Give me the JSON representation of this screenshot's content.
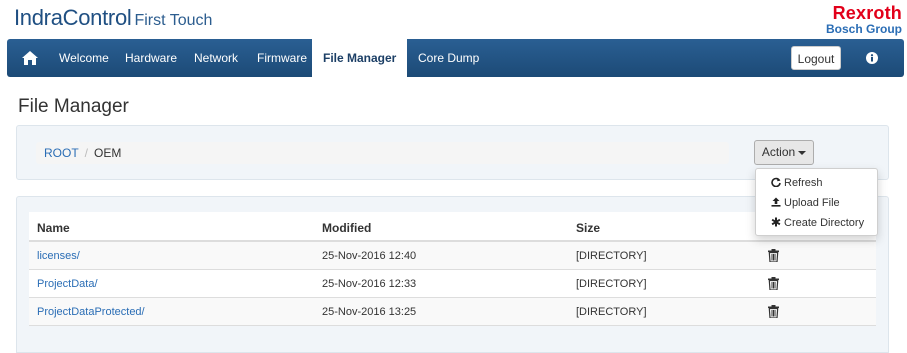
{
  "header": {
    "brand_main": "IndraControl",
    "brand_sub": "First Touch",
    "logo_line1": "Rexroth",
    "logo_line2": "Bosch Group"
  },
  "nav": {
    "home_icon": "home-icon",
    "items": [
      {
        "label": "Welcome",
        "active": false
      },
      {
        "label": "Hardware",
        "active": false
      },
      {
        "label": "Network",
        "active": false
      },
      {
        "label": "Firmware",
        "active": false
      },
      {
        "label": "File Manager",
        "active": true
      },
      {
        "label": "Core Dump",
        "active": false
      }
    ],
    "logout_label": "Logout",
    "info_icon": "info-icon"
  },
  "page": {
    "title": "File Manager"
  },
  "breadcrumb": {
    "root": "ROOT",
    "separator": "/",
    "current": "OEM"
  },
  "action": {
    "label": "Action",
    "menu": [
      {
        "icon": "refresh-icon",
        "label": "Refresh"
      },
      {
        "icon": "upload-icon",
        "label": "Upload File"
      },
      {
        "icon": "asterisk-icon",
        "label": "Create Directory"
      }
    ]
  },
  "table": {
    "columns": [
      "Name",
      "Modified",
      "Size"
    ],
    "rows": [
      {
        "name": "licenses/",
        "modified": "25-Nov-2016 12:40",
        "size": "[DIRECTORY]"
      },
      {
        "name": "ProjectData/",
        "modified": "25-Nov-2016 12:33",
        "size": "[DIRECTORY]"
      },
      {
        "name": "ProjectDataProtected/",
        "modified": "25-Nov-2016 13:25",
        "size": "[DIRECTORY]"
      }
    ],
    "row_action_icon": "trash-icon"
  },
  "colors": {
    "navbar": "#1f4d7b",
    "link": "#2a6db5",
    "brand_red": "#e2001a"
  }
}
